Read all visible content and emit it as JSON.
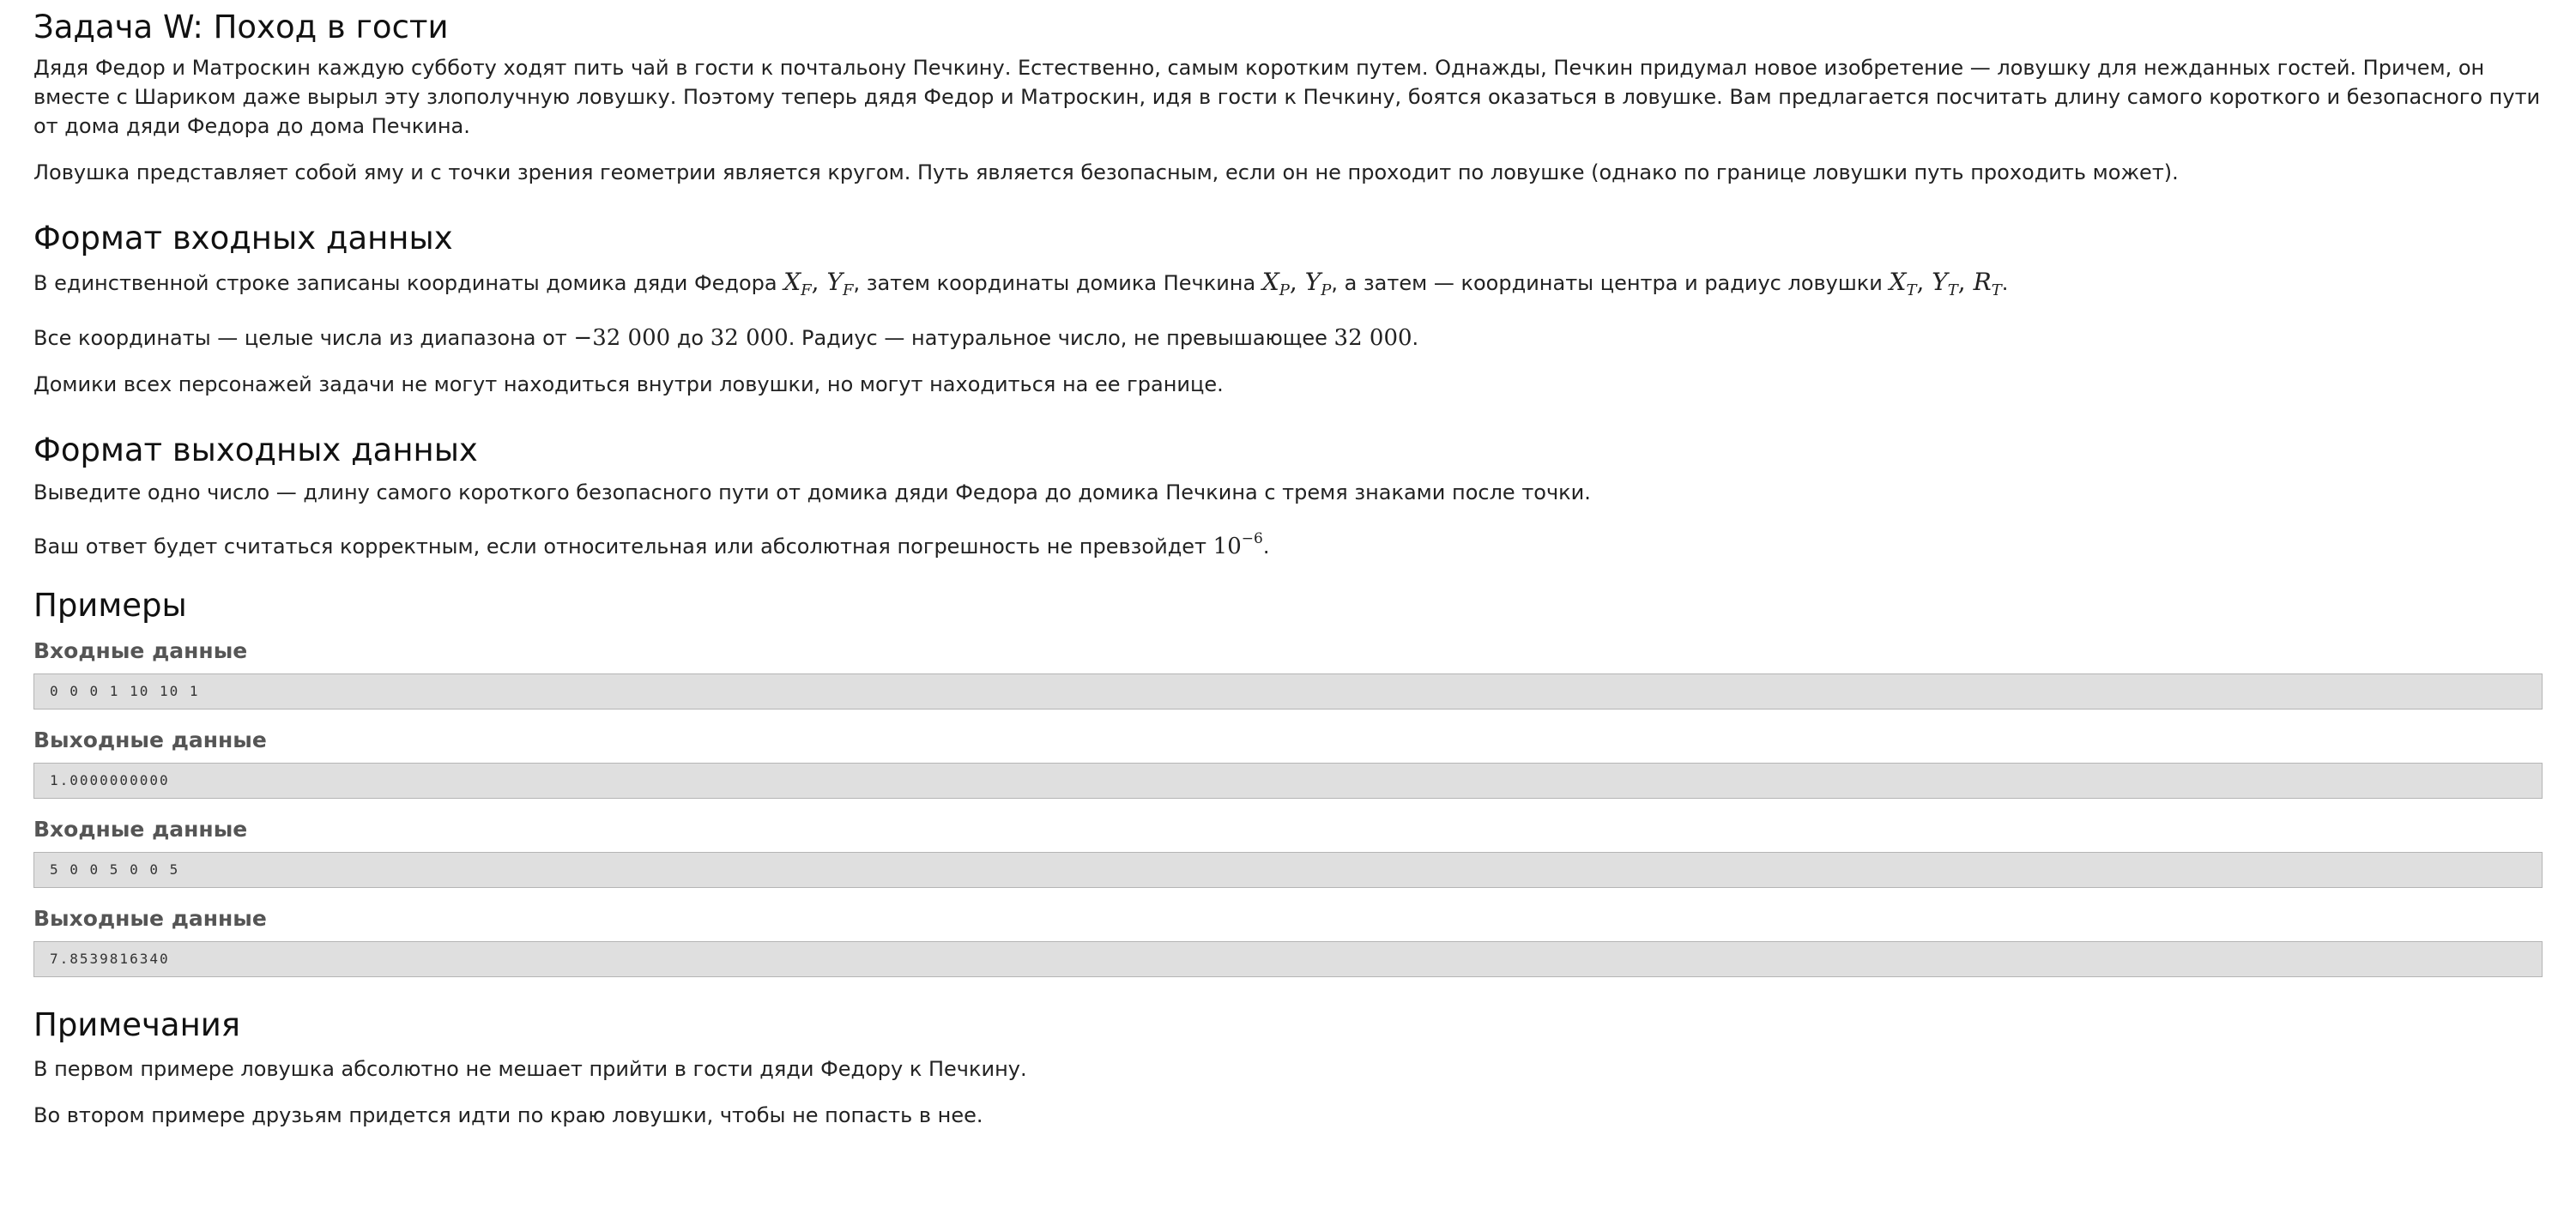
{
  "title": "Задача W: Поход в гости",
  "statement": {
    "p1": "Дядя Федор и Матроскин каждую субботу ходят пить чай в гости к почтальону Печкину. Естественно, самым коротким путем. Однажды, Печкин придумал новое изобретение — ловушку для нежданных гостей. Причем, он вместе с Шариком даже вырыл эту злополучную ловушку. Поэтому теперь дядя Федор и Матроскин, идя в гости к Печкину, боятся оказаться в ловушке. Вам предлагается посчитать длину самого короткого и безопасного пути от дома дяди Федора до дома Печкина.",
    "p2": "Ловушка представляет собой яму и с точки зрения геометрии является кругом. Путь является безопасным, если он не проходит по ловушке (однако по границе ловушки путь проходить может)."
  },
  "input_format": {
    "heading": "Формат входных данных",
    "p1_a": "В единственной строке записаны координаты домика дяди Федора ",
    "p1_b": ", затем координаты домика Печкина ",
    "p1_c": ", а затем — координаты центра и радиус ловушки ",
    "p1_d": ".",
    "p2_a": "Все координаты — целые числа из диапазона от ",
    "p2_b": " до ",
    "p2_c": ". Радиус — натуральное число, не превышающее ",
    "p2_d": ".",
    "p3": "Домики всех персонажей задачи не могут находиться внутри ловушки, но могут находиться на ее границе.",
    "math": {
      "xf": "X",
      "xf_sub": "F",
      "yf": "Y",
      "yf_sub": "F",
      "xp": "X",
      "xp_sub": "P",
      "yp": "Y",
      "yp_sub": "P",
      "xt": "X",
      "xt_sub": "T",
      "yt": "Y",
      "yt_sub": "T",
      "rt": "R",
      "rt_sub": "T",
      "comma": ", ",
      "min": "−32 000",
      "max": "32 000",
      "rmax": "32 000"
    }
  },
  "output_format": {
    "heading": "Формат выходных данных",
    "p1": "Выведите одно число — длину самого короткого безопасного пути от домика дяди Федора до домика Печкина с тремя знаками после точки.",
    "p2_a": "Ваш ответ будет считаться корректным, если относительная или абсолютная погрешность не превзойдет ",
    "p2_base": "10",
    "p2_exp": "−6",
    "p2_b": "."
  },
  "examples": {
    "heading": "Примеры",
    "items": [
      {
        "label": "Входные данные",
        "value": "0 0 0 1 10 10 1"
      },
      {
        "label": "Выходные данные",
        "value": "1.0000000000"
      },
      {
        "label": "Входные данные",
        "value": "5 0 0 5 0 0 5"
      },
      {
        "label": "Выходные данные",
        "value": "7.8539816340"
      }
    ]
  },
  "notes": {
    "heading": "Примечания",
    "p1": "В первом примере ловушка абсолютно не мешает прийти в гости дяди Федору к Печкину.",
    "p2": "Во втором примере друзьям придется идти по краю ловушки, чтобы не попасть в нее."
  }
}
